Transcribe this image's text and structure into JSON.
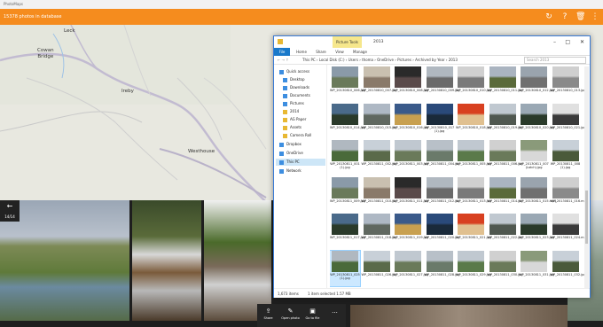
{
  "window_title": "PhotoMaps",
  "app_bar": {
    "title": "15378 photos in database",
    "icons": [
      "refresh-icon",
      "help-icon",
      "delete-icon",
      "settings-icon"
    ]
  },
  "map": {
    "labels": {
      "leck": "Leck",
      "cowan_bridge": "Cowan\nBridge",
      "ireby": "Ireby",
      "westhouse": "Westhouse"
    },
    "colors": {
      "land": "#e8e8e0",
      "road": "#b9b2c9",
      "water": "#9ec2e6"
    }
  },
  "strip": {
    "back_label": "←",
    "counter": "14/14"
  },
  "bottom_bar": {
    "share": "Share",
    "open_photo": "Open photo",
    "go_to_file": "Go to file",
    "more": "..."
  },
  "explorer": {
    "title": "2013",
    "picture_tools": "Picture Tools",
    "tabs": [
      "File",
      "Home",
      "Share",
      "View",
      "Manage"
    ],
    "address": [
      "This PC",
      "Local Disk (C:)",
      "Users",
      "thoma",
      "OneDrive",
      "Pictures",
      "Archived by Year",
      "2013"
    ],
    "search_placeholder": "Search 2013",
    "nav": [
      "Quick access",
      "Desktop",
      "Downloads",
      "Documents",
      "Pictures",
      "2014",
      "AG Paper",
      "Assets",
      "Camera Roll",
      "Dropbox",
      "OneDrive",
      "This PC",
      "Network"
    ],
    "status_left": "1,673 items",
    "status_mid": "1 item selected  1.57 MB",
    "files": [
      "WP_20130810_006.jpg",
      "WP_20130810_007.jpg",
      "WP_20130810_008.jpg",
      "WP_20130810_009.jpg",
      "WP_20130810_010.jpg",
      "WP_20130810_011.jpg",
      "WP_20130810_012.jpg",
      "WP_20130810_013.jpg",
      "WP_20130810_014.jpg",
      "WP_20130810_015.jpg",
      "WP_20130810_016.jpg",
      "WP_20130810_017 (1).jpg",
      "WP_20130810_018.jpg",
      "WP_20130810_019.jpg",
      "WP_20130810_020.jpg",
      "WP_20130810_021.jpg",
      "WP_20130811_001 (1).jpg",
      "WP_20130811_002.jpg",
      "WP_20130811_003.jpg",
      "WP_20130811_004.jpg",
      "WP_20130811_005.jpg",
      "WP_20130811_006.jpg",
      "WP_20130811_007 (Latch).jpg",
      "WP_20130811_008 (1).jpg",
      "WP_20130811_009.jpg",
      "WP_20130811_010.jpg",
      "WP_20130811_011.jpg",
      "WP_20130811_012.jpg",
      "WP_20130811_013.jpg",
      "WP_20130811_014.jpg",
      "WP_20130811_015.mp4",
      "WP_20130811_016.mp4",
      "WP_20130811_017.jpg",
      "WP_20130811_018.jpg",
      "WP_20130811_019.jpg",
      "WP_20130811_020.jpg",
      "WP_20130811_021.jpg",
      "WP_20130811_022.jpg",
      "WP_20130811_023.jpg",
      "WP_20130811_024.mp4",
      "WP_20130811_025 (1).jpg",
      "WP_20130811_026.jpg",
      "WP_20130811_027.jpg",
      "WP_20130811_028.jpg",
      "WP_20130811_029.jpg",
      "WP_20130811_030.jpg",
      "WP_20130811_031.jpg",
      "WP_20130811_032.jpg"
    ]
  }
}
